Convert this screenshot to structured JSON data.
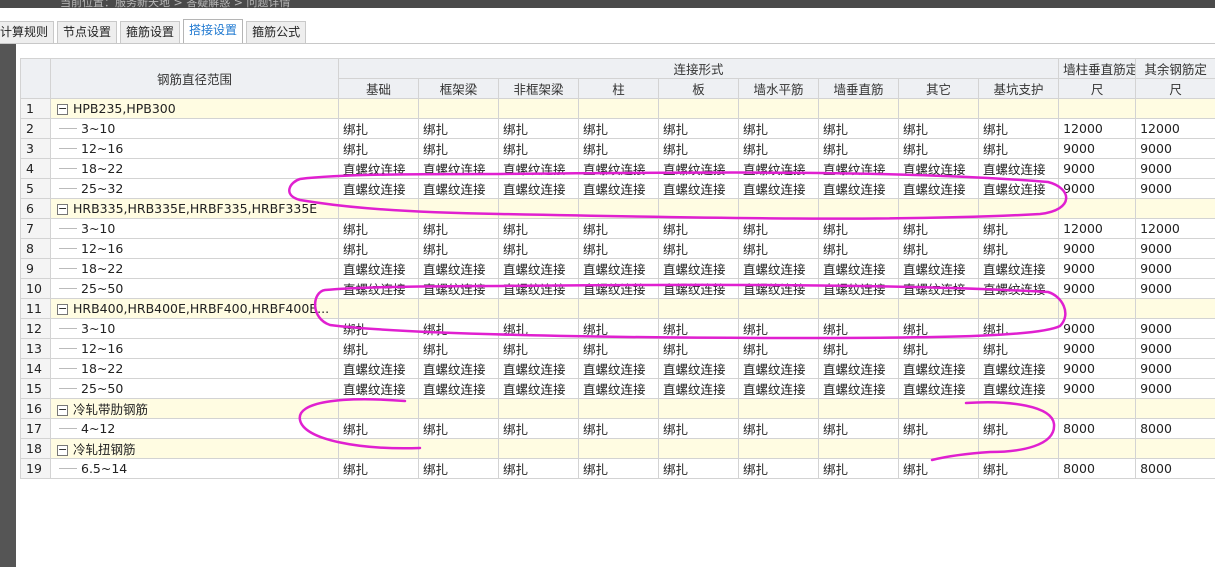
{
  "breadcrumb": "当前位置：服务新天地 > 答疑解惑 > 问题详情",
  "tabs": [
    "计算规则",
    "节点设置",
    "箍筋设置",
    "搭接设置",
    "箍筋公式"
  ],
  "active_tab": 3,
  "headers": {
    "range": "钢筋直径范围",
    "connect_form": "连接形式",
    "cols": [
      "基础",
      "框架梁",
      "非框架梁",
      "柱",
      "板",
      "墙水平筋",
      "墙垂直筋",
      "其它",
      "基坑支护"
    ],
    "wall_col_len": "墙柱垂直筋定尺",
    "other_len": "其余钢筋定尺"
  },
  "rows": [
    {
      "n": "1",
      "group": true,
      "label": "HPB235,HPB300"
    },
    {
      "n": "2",
      "label": "3~10",
      "conn": [
        "绑扎",
        "绑扎",
        "绑扎",
        "绑扎",
        "绑扎",
        "绑扎",
        "绑扎",
        "绑扎",
        "绑扎"
      ],
      "len1": "12000",
      "len2": "12000"
    },
    {
      "n": "3",
      "label": "12~16",
      "conn": [
        "绑扎",
        "绑扎",
        "绑扎",
        "绑扎",
        "绑扎",
        "绑扎",
        "绑扎",
        "绑扎",
        "绑扎"
      ],
      "len1": "9000",
      "len2": "9000"
    },
    {
      "n": "4",
      "label": "18~22",
      "conn": [
        "直螺纹连接",
        "直螺纹连接",
        "直螺纹连接",
        "直螺纹连接",
        "直螺纹连接",
        "直螺纹连接",
        "直螺纹连接",
        "直螺纹连接",
        "直螺纹连接"
      ],
      "len1": "9000",
      "len2": "9000"
    },
    {
      "n": "5",
      "label": "25~32",
      "conn": [
        "直螺纹连接",
        "直螺纹连接",
        "直螺纹连接",
        "直螺纹连接",
        "直螺纹连接",
        "直螺纹连接",
        "直螺纹连接",
        "直螺纹连接",
        "直螺纹连接"
      ],
      "len1": "9000",
      "len2": "9000"
    },
    {
      "n": "6",
      "group": true,
      "label": "HRB335,HRB335E,HRBF335,HRBF335E"
    },
    {
      "n": "7",
      "label": "3~10",
      "conn": [
        "绑扎",
        "绑扎",
        "绑扎",
        "绑扎",
        "绑扎",
        "绑扎",
        "绑扎",
        "绑扎",
        "绑扎"
      ],
      "len1": "12000",
      "len2": "12000"
    },
    {
      "n": "8",
      "label": "12~16",
      "conn": [
        "绑扎",
        "绑扎",
        "绑扎",
        "绑扎",
        "绑扎",
        "绑扎",
        "绑扎",
        "绑扎",
        "绑扎"
      ],
      "len1": "9000",
      "len2": "9000"
    },
    {
      "n": "9",
      "label": "18~22",
      "conn": [
        "直螺纹连接",
        "直螺纹连接",
        "直螺纹连接",
        "直螺纹连接",
        "直螺纹连接",
        "直螺纹连接",
        "直螺纹连接",
        "直螺纹连接",
        "直螺纹连接"
      ],
      "len1": "9000",
      "len2": "9000"
    },
    {
      "n": "10",
      "label": "25~50",
      "conn": [
        "直螺纹连接",
        "直螺纹连接",
        "直螺纹连接",
        "直螺纹连接",
        "直螺纹连接",
        "直螺纹连接",
        "直螺纹连接",
        "直螺纹连接",
        "直螺纹连接"
      ],
      "len1": "9000",
      "len2": "9000"
    },
    {
      "n": "11",
      "group": true,
      "label": "HRB400,HRB400E,HRBF400,HRBF400E..."
    },
    {
      "n": "12",
      "label": "3~10",
      "conn": [
        "绑扎",
        "绑扎",
        "绑扎",
        "绑扎",
        "绑扎",
        "绑扎",
        "绑扎",
        "绑扎",
        "绑扎"
      ],
      "len1": "9000",
      "len2": "9000"
    },
    {
      "n": "13",
      "label": "12~16",
      "conn": [
        "绑扎",
        "绑扎",
        "绑扎",
        "绑扎",
        "绑扎",
        "绑扎",
        "绑扎",
        "绑扎",
        "绑扎"
      ],
      "len1": "9000",
      "len2": "9000"
    },
    {
      "n": "14",
      "label": "18~22",
      "conn": [
        "直螺纹连接",
        "直螺纹连接",
        "直螺纹连接",
        "直螺纹连接",
        "直螺纹连接",
        "直螺纹连接",
        "直螺纹连接",
        "直螺纹连接",
        "直螺纹连接"
      ],
      "len1": "9000",
      "len2": "9000"
    },
    {
      "n": "15",
      "label": "25~50",
      "conn": [
        "直螺纹连接",
        "直螺纹连接",
        "直螺纹连接",
        "直螺纹连接",
        "直螺纹连接",
        "直螺纹连接",
        "直螺纹连接",
        "直螺纹连接",
        "直螺纹连接"
      ],
      "len1": "9000",
      "len2": "9000"
    },
    {
      "n": "16",
      "group": true,
      "label": "冷轧带肋钢筋"
    },
    {
      "n": "17",
      "label": "4~12",
      "conn": [
        "绑扎",
        "绑扎",
        "绑扎",
        "绑扎",
        "绑扎",
        "绑扎",
        "绑扎",
        "绑扎",
        "绑扎"
      ],
      "len1": "8000",
      "len2": "8000"
    },
    {
      "n": "18",
      "group": true,
      "label": "冷轧扭钢筋"
    },
    {
      "n": "19",
      "label": "6.5~14",
      "conn": [
        "绑扎",
        "绑扎",
        "绑扎",
        "绑扎",
        "绑扎",
        "绑扎",
        "绑扎",
        "绑扎",
        "绑扎"
      ],
      "len1": "8000",
      "len2": "8000"
    }
  ],
  "colors": {
    "annotation": "#e020d0",
    "active_tab_text": "#1e78d0",
    "group_row_bg": "#fffce2"
  },
  "icons": {
    "expander": "minus-box-icon"
  }
}
